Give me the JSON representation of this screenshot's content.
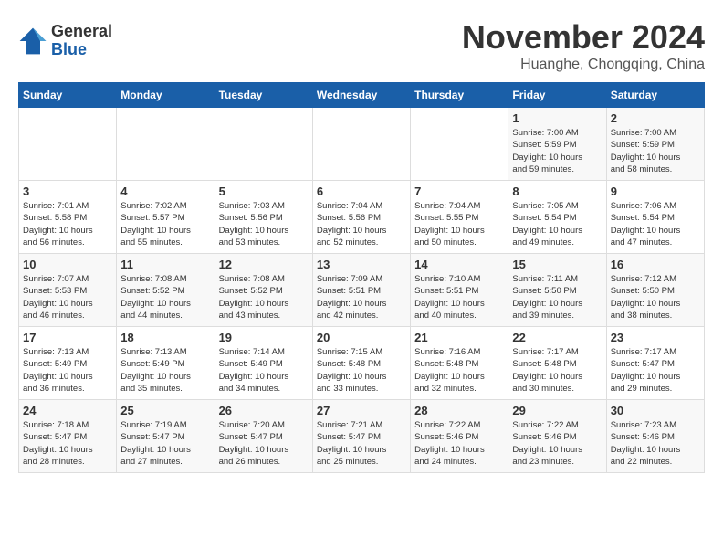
{
  "logo": {
    "general": "General",
    "blue": "Blue"
  },
  "header": {
    "month": "November 2024",
    "location": "Huanghe, Chongqing, China"
  },
  "weekdays": [
    "Sunday",
    "Monday",
    "Tuesday",
    "Wednesday",
    "Thursday",
    "Friday",
    "Saturday"
  ],
  "weeks": [
    [
      {
        "day": "",
        "info": ""
      },
      {
        "day": "",
        "info": ""
      },
      {
        "day": "",
        "info": ""
      },
      {
        "day": "",
        "info": ""
      },
      {
        "day": "",
        "info": ""
      },
      {
        "day": "1",
        "info": "Sunrise: 7:00 AM\nSunset: 5:59 PM\nDaylight: 10 hours\nand 59 minutes."
      },
      {
        "day": "2",
        "info": "Sunrise: 7:00 AM\nSunset: 5:59 PM\nDaylight: 10 hours\nand 58 minutes."
      }
    ],
    [
      {
        "day": "3",
        "info": "Sunrise: 7:01 AM\nSunset: 5:58 PM\nDaylight: 10 hours\nand 56 minutes."
      },
      {
        "day": "4",
        "info": "Sunrise: 7:02 AM\nSunset: 5:57 PM\nDaylight: 10 hours\nand 55 minutes."
      },
      {
        "day": "5",
        "info": "Sunrise: 7:03 AM\nSunset: 5:56 PM\nDaylight: 10 hours\nand 53 minutes."
      },
      {
        "day": "6",
        "info": "Sunrise: 7:04 AM\nSunset: 5:56 PM\nDaylight: 10 hours\nand 52 minutes."
      },
      {
        "day": "7",
        "info": "Sunrise: 7:04 AM\nSunset: 5:55 PM\nDaylight: 10 hours\nand 50 minutes."
      },
      {
        "day": "8",
        "info": "Sunrise: 7:05 AM\nSunset: 5:54 PM\nDaylight: 10 hours\nand 49 minutes."
      },
      {
        "day": "9",
        "info": "Sunrise: 7:06 AM\nSunset: 5:54 PM\nDaylight: 10 hours\nand 47 minutes."
      }
    ],
    [
      {
        "day": "10",
        "info": "Sunrise: 7:07 AM\nSunset: 5:53 PM\nDaylight: 10 hours\nand 46 minutes."
      },
      {
        "day": "11",
        "info": "Sunrise: 7:08 AM\nSunset: 5:52 PM\nDaylight: 10 hours\nand 44 minutes."
      },
      {
        "day": "12",
        "info": "Sunrise: 7:08 AM\nSunset: 5:52 PM\nDaylight: 10 hours\nand 43 minutes."
      },
      {
        "day": "13",
        "info": "Sunrise: 7:09 AM\nSunset: 5:51 PM\nDaylight: 10 hours\nand 42 minutes."
      },
      {
        "day": "14",
        "info": "Sunrise: 7:10 AM\nSunset: 5:51 PM\nDaylight: 10 hours\nand 40 minutes."
      },
      {
        "day": "15",
        "info": "Sunrise: 7:11 AM\nSunset: 5:50 PM\nDaylight: 10 hours\nand 39 minutes."
      },
      {
        "day": "16",
        "info": "Sunrise: 7:12 AM\nSunset: 5:50 PM\nDaylight: 10 hours\nand 38 minutes."
      }
    ],
    [
      {
        "day": "17",
        "info": "Sunrise: 7:13 AM\nSunset: 5:49 PM\nDaylight: 10 hours\nand 36 minutes."
      },
      {
        "day": "18",
        "info": "Sunrise: 7:13 AM\nSunset: 5:49 PM\nDaylight: 10 hours\nand 35 minutes."
      },
      {
        "day": "19",
        "info": "Sunrise: 7:14 AM\nSunset: 5:49 PM\nDaylight: 10 hours\nand 34 minutes."
      },
      {
        "day": "20",
        "info": "Sunrise: 7:15 AM\nSunset: 5:48 PM\nDaylight: 10 hours\nand 33 minutes."
      },
      {
        "day": "21",
        "info": "Sunrise: 7:16 AM\nSunset: 5:48 PM\nDaylight: 10 hours\nand 32 minutes."
      },
      {
        "day": "22",
        "info": "Sunrise: 7:17 AM\nSunset: 5:48 PM\nDaylight: 10 hours\nand 30 minutes."
      },
      {
        "day": "23",
        "info": "Sunrise: 7:17 AM\nSunset: 5:47 PM\nDaylight: 10 hours\nand 29 minutes."
      }
    ],
    [
      {
        "day": "24",
        "info": "Sunrise: 7:18 AM\nSunset: 5:47 PM\nDaylight: 10 hours\nand 28 minutes."
      },
      {
        "day": "25",
        "info": "Sunrise: 7:19 AM\nSunset: 5:47 PM\nDaylight: 10 hours\nand 27 minutes."
      },
      {
        "day": "26",
        "info": "Sunrise: 7:20 AM\nSunset: 5:47 PM\nDaylight: 10 hours\nand 26 minutes."
      },
      {
        "day": "27",
        "info": "Sunrise: 7:21 AM\nSunset: 5:47 PM\nDaylight: 10 hours\nand 25 minutes."
      },
      {
        "day": "28",
        "info": "Sunrise: 7:22 AM\nSunset: 5:46 PM\nDaylight: 10 hours\nand 24 minutes."
      },
      {
        "day": "29",
        "info": "Sunrise: 7:22 AM\nSunset: 5:46 PM\nDaylight: 10 hours\nand 23 minutes."
      },
      {
        "day": "30",
        "info": "Sunrise: 7:23 AM\nSunset: 5:46 PM\nDaylight: 10 hours\nand 22 minutes."
      }
    ]
  ]
}
